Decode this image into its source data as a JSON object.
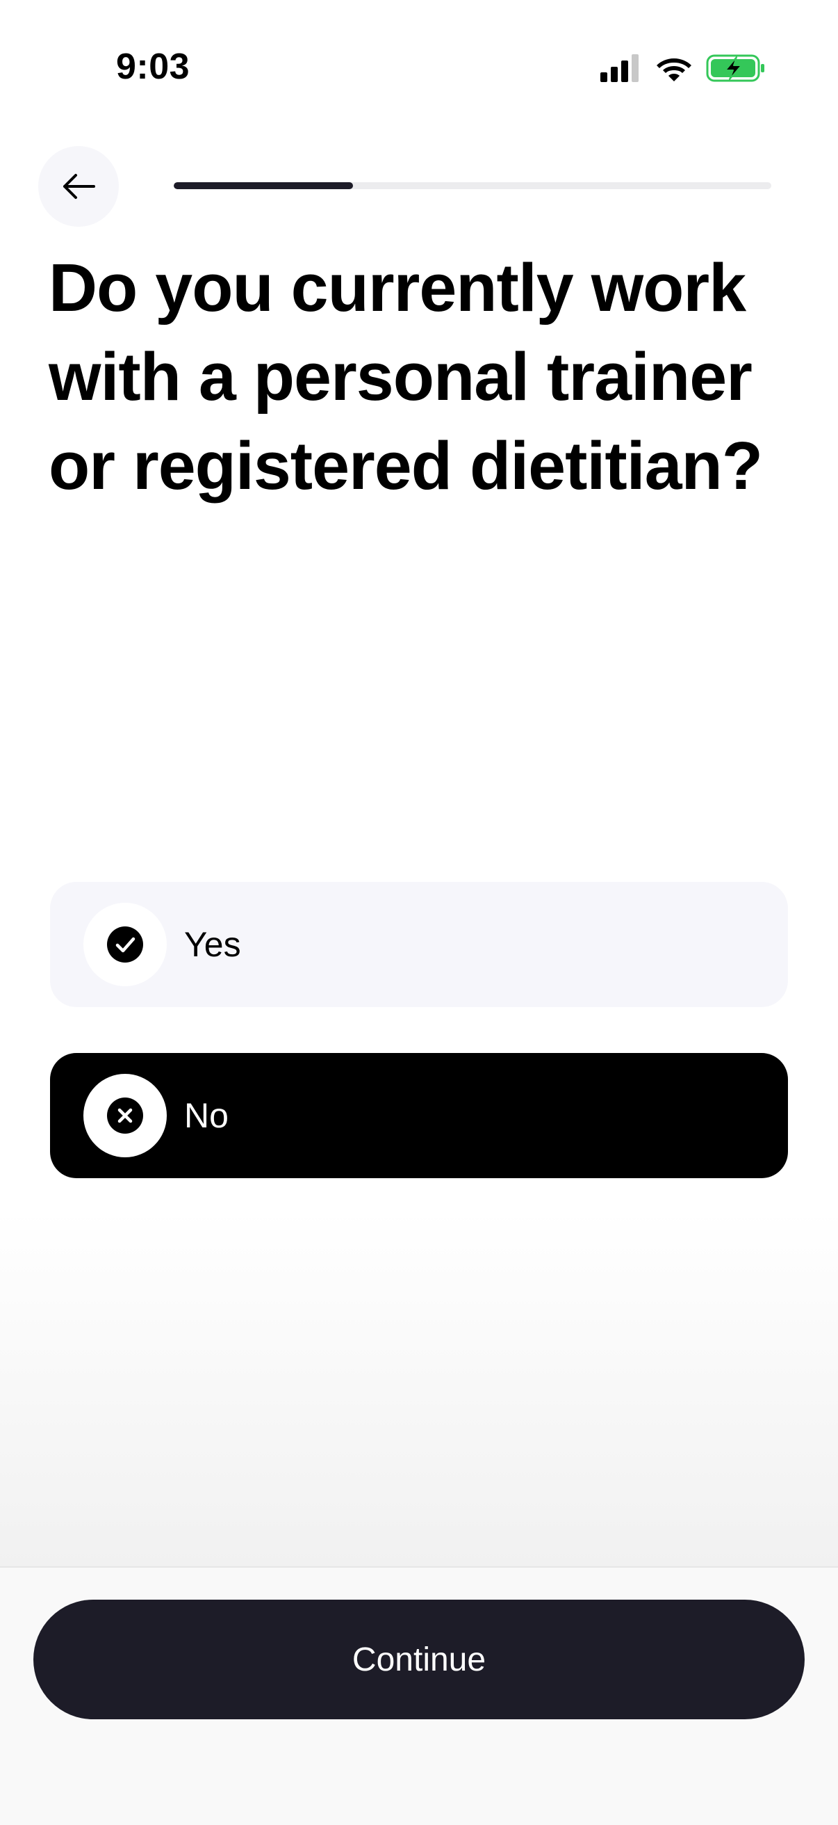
{
  "status_bar": {
    "time": "9:03",
    "signal_icon": "cellular-signal-icon",
    "wifi_icon": "wifi-icon",
    "battery_icon": "battery-charging-icon",
    "battery_color": "#34c759"
  },
  "header": {
    "back_icon": "arrow-left-icon",
    "progress_fraction": 0.3
  },
  "question": {
    "title": "Do you currently work with a personal trainer or registered dietitian?"
  },
  "options": [
    {
      "label": "Yes",
      "icon": "check-circle-icon",
      "selected": false
    },
    {
      "label": "No",
      "icon": "x-circle-icon",
      "selected": true
    }
  ],
  "footer": {
    "continue_label": "Continue"
  },
  "colors": {
    "accent_dark": "#1d1c28",
    "selected_option_bg": "#000000",
    "unselected_option_bg": "#f6f6fb"
  }
}
